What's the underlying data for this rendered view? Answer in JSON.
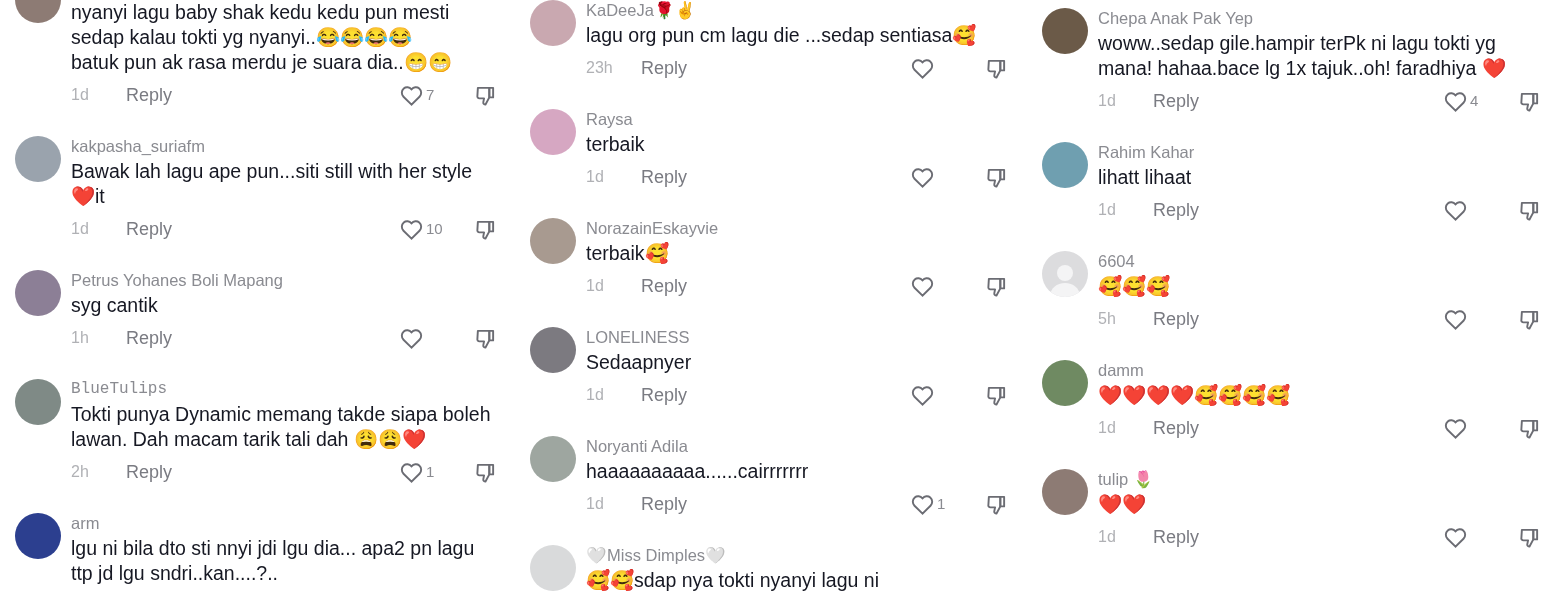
{
  "columns": [
    {
      "comments": [
        {
          "default_avatar": false,
          "text": "nyanyi lagu baby shak kedu kedu pun mesti\nsedap kalau tokti yg nyanyi..😂😂😂😂\nbatuk pun ak rasa merdu je suara dia..😁😁",
          "time": "1d",
          "reply": "Reply",
          "likes": "7"
        },
        {
          "default_avatar": false,
          "mono_name": false,
          "username": "kakpasha_suriafm",
          "text": "Bawak lah lagu ape pun...siti still with her style\n❤️it",
          "time": "1d",
          "reply": "Reply",
          "likes": "10"
        },
        {
          "default_avatar": false,
          "mono_name": false,
          "username": "Petrus Yohanes Boli Mapang",
          "text": "syg cantik",
          "time": "1h",
          "reply": "Reply"
        },
        {
          "default_avatar": false,
          "mono_name": true,
          "username": "BlueTulips",
          "text": "Tokti punya Dynamic memang takde siapa boleh\nlawan. Dah macam tarik tali dah 😩😩❤️",
          "time": "2h",
          "reply": "Reply",
          "likes": "1"
        },
        {
          "default_avatar": false,
          "mono_name": false,
          "username": "arm",
          "text": "lgu ni bila dto sti nnyi jdi lgu dia... apa2 pn lagu\nttp jd lgu sndri..kan....?.."
        }
      ]
    },
    {
      "comments": [
        {
          "default_avatar": false,
          "mono_name": false,
          "username": "KaDeeJa🌹✌️",
          "text": "lagu org pun cm lagu die ...sedap sentiasa🥰",
          "time": "23h",
          "reply": "Reply"
        },
        {
          "default_avatar": false,
          "mono_name": false,
          "username": "Raysa",
          "text": "terbaik",
          "time": "1d",
          "reply": "Reply"
        },
        {
          "default_avatar": false,
          "mono_name": false,
          "username": "NorazainEskayvie",
          "text": "terbaik🥰",
          "time": "1d",
          "reply": "Reply"
        },
        {
          "default_avatar": false,
          "mono_name": false,
          "username": "LONELINESS",
          "text": "Sedaapnyer",
          "time": "1d",
          "reply": "Reply"
        },
        {
          "default_avatar": false,
          "mono_name": false,
          "username": "Noryanti Adila",
          "text": "haaaaaaaaaa......cairrrrrrr",
          "time": "1d",
          "reply": "Reply",
          "likes": "1"
        },
        {
          "default_avatar": false,
          "mono_name": false,
          "username": "🤍Miss Dimples🤍",
          "text": "🥰🥰sdap nya tokti nyanyi lagu ni"
        }
      ]
    },
    {
      "comments": [
        {
          "default_avatar": false,
          "mono_name": false,
          "username": "Chepa Anak Pak Yep",
          "text": "woww..sedap gile.hampir terPk ni lagu tokti yg\nmana! hahaa.bace lg 1x tajuk..oh! faradhiya ❤️",
          "time": "1d",
          "reply": "Reply",
          "likes": "4"
        },
        {
          "default_avatar": false,
          "mono_name": false,
          "username": "Rahim Kahar",
          "text": "lihatt lihaat",
          "time": "1d",
          "reply": "Reply"
        },
        {
          "default_avatar": true,
          "mono_name": false,
          "username": "6604",
          "text": "🥰🥰🥰",
          "time": "5h",
          "reply": "Reply"
        },
        {
          "default_avatar": false,
          "mono_name": false,
          "username": "damm",
          "text": "❤️❤️❤️❤️🥰🥰🥰🥰",
          "time": "1d",
          "reply": "Reply"
        },
        {
          "default_avatar": false,
          "mono_name": false,
          "username": "tulip 🌷",
          "text": "❤️❤️",
          "time": "1d",
          "reply": "Reply"
        }
      ]
    }
  ]
}
